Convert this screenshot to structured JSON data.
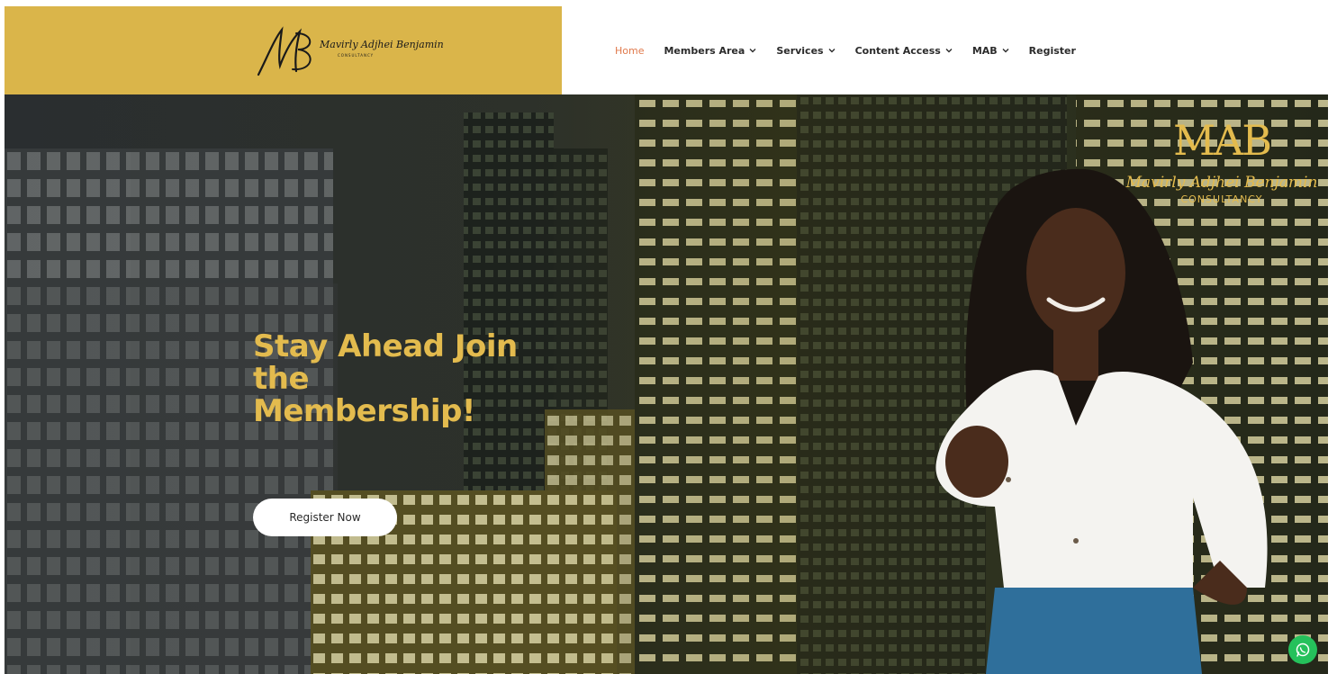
{
  "logo": {
    "initials": "MB",
    "name": "Mavirly Adjhei Benjamin",
    "subtitle": "CONSULTANCY"
  },
  "nav": {
    "items": [
      {
        "label": "Home",
        "dropdown": false,
        "active": true
      },
      {
        "label": "Members Area",
        "dropdown": true,
        "active": false
      },
      {
        "label": "Services",
        "dropdown": true,
        "active": false
      },
      {
        "label": "Content Access",
        "dropdown": true,
        "active": false
      },
      {
        "label": "MAB",
        "dropdown": true,
        "active": false
      },
      {
        "label": "Register",
        "dropdown": false,
        "active": false
      }
    ]
  },
  "hero": {
    "headline_line1": "Stay Ahead Join",
    "headline_line2": "the",
    "headline_line3": "Membership!",
    "cta_label": "Register Now"
  },
  "brand": {
    "mark": "MAB",
    "name": "Mavirly Adjhei Benjamin",
    "subtitle": "CONSULTANCY"
  },
  "colors": {
    "gold": "#dab54a",
    "headline_gold": "#e3bb4e",
    "active_nav": "#e0794b",
    "chat_green": "#25c15b"
  },
  "icons": {
    "chat": "whatsapp-icon",
    "dropdown": "chevron-down-icon"
  }
}
